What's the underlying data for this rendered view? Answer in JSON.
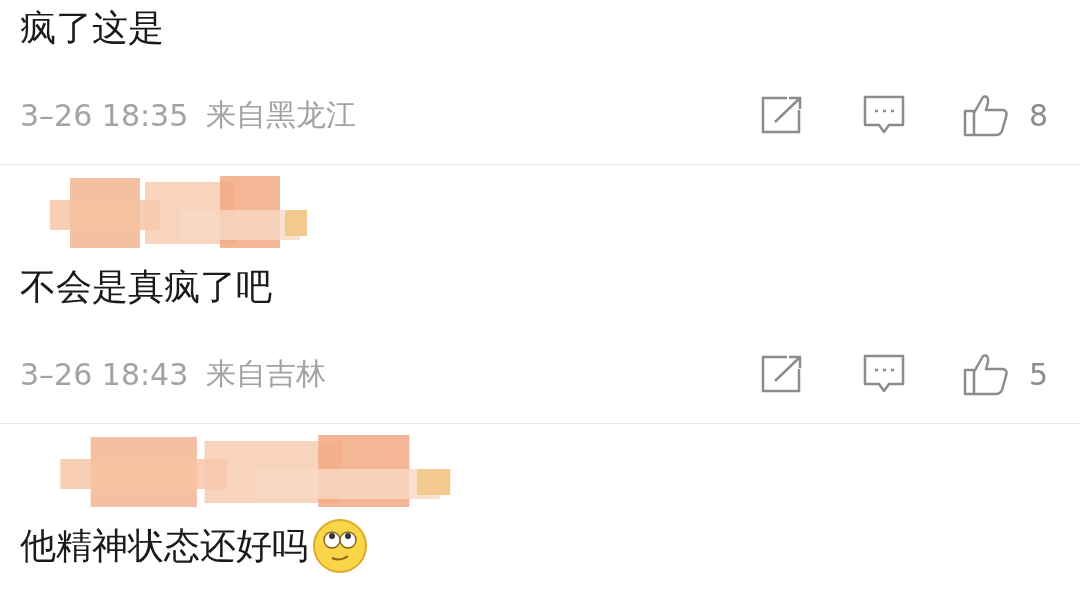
{
  "comments": [
    {
      "text": "疯了这是",
      "meta": {
        "time": "3–26 18:35",
        "location": "来自黑龙江",
        "likes": "8"
      }
    },
    {
      "username": {
        "kind": "redacted"
      },
      "text": "不会是真疯了吧",
      "meta": {
        "time": "3–26 18:43",
        "location": "来自吉林",
        "likes": "5"
      }
    },
    {
      "username": {
        "kind": "redacted"
      },
      "text": "他精神状态还好吗",
      "emoji": true
    }
  ]
}
